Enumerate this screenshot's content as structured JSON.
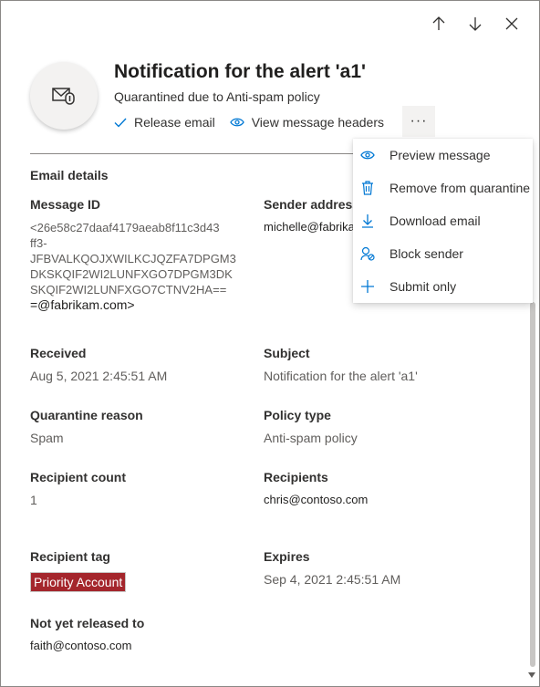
{
  "panel": {
    "title": "Notification for the alert 'a1'",
    "subtitle": "Quarantined due to Anti-spam policy",
    "actions": {
      "release": "Release email",
      "headers": "View message headers",
      "more": "···"
    }
  },
  "nav_icons": [
    "arrow-up-icon",
    "arrow-down-icon",
    "close-icon"
  ],
  "details": {
    "section_title": "Email details",
    "message_id": {
      "label": "Message ID",
      "value_lines": [
        "<26e58c27daaf4179aeab8f11c3d43",
        "ff3-",
        "JFBVALKQOJXWILKCJQZFA7DPGM3",
        "DKSKQIF2WI2LUNFXGO7DPGM3DK",
        "SKQIF2WI2LUNFXGO7CTNV2HA==",
        "=@fabrikam.com>"
      ]
    },
    "sender_address": {
      "label": "Sender address",
      "value": "michelle@fabrika"
    },
    "received": {
      "label": "Received",
      "value": "Aug 5, 2021 2:45:51 AM"
    },
    "subject": {
      "label": "Subject",
      "value": "Notification for the alert 'a1'"
    },
    "quarantine_reason": {
      "label": "Quarantine reason",
      "value": "Spam"
    },
    "policy_type": {
      "label": "Policy type",
      "value": "Anti-spam policy"
    },
    "recipient_count": {
      "label": "Recipient count",
      "value": "1"
    },
    "recipients": {
      "label": "Recipients",
      "value": "chris@contoso.com"
    },
    "recipient_tag": {
      "label": "Recipient tag",
      "value": "Priority Account"
    },
    "expires": {
      "label": "Expires",
      "value": "Sep 4, 2021 2:45:51 AM"
    },
    "not_released": {
      "label": "Not yet released to",
      "value": "faith@contoso.com"
    }
  },
  "menu": {
    "items": [
      {
        "label": "Preview message",
        "icon": "eye-icon"
      },
      {
        "label": "Remove from quarantine",
        "icon": "trash-icon"
      },
      {
        "label": "Download email",
        "icon": "download-icon"
      },
      {
        "label": "Block sender",
        "icon": "block-user-icon"
      },
      {
        "label": "Submit only",
        "icon": "plus-icon"
      }
    ]
  },
  "colors": {
    "accent": "#0078d4",
    "badge": "#a4262c"
  }
}
